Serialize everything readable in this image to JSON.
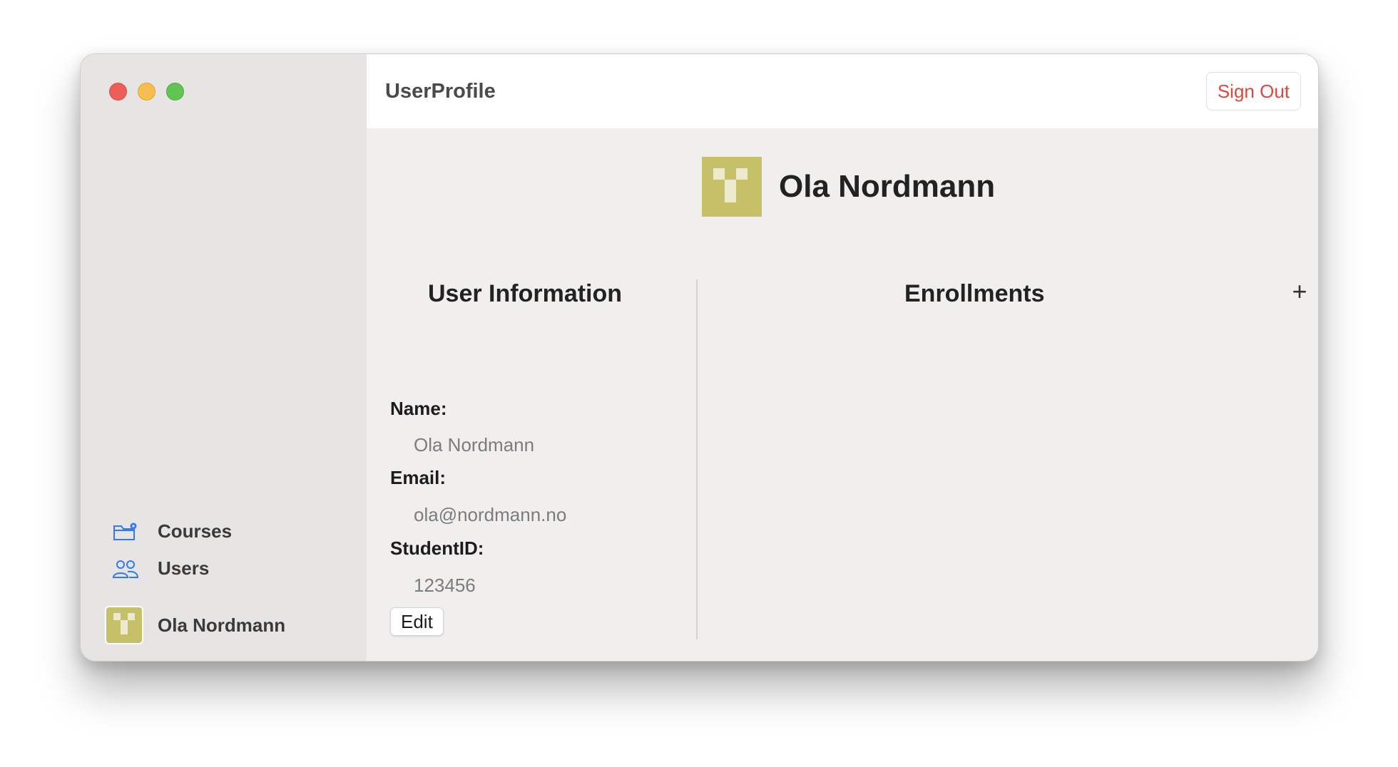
{
  "window": {
    "title": "UserProfile"
  },
  "toolbar": {
    "sign_out_label": "Sign Out"
  },
  "sidebar": {
    "items": [
      {
        "label": "Courses",
        "icon": "folder-gear-icon"
      },
      {
        "label": "Users",
        "icon": "users-icon"
      }
    ],
    "profile": {
      "name": "Ola Nordmann"
    }
  },
  "profile": {
    "display_name": "Ola Nordmann",
    "user_info": {
      "title": "User Information",
      "name_label": "Name:",
      "name_value": "Ola Nordmann",
      "email_label": "Email:",
      "email_value": "ola@nordmann.no",
      "student_id_label": "StudentID:",
      "student_id_value": "123456",
      "edit_label": "Edit"
    },
    "enrollments": {
      "title": "Enrollments",
      "add_label": "+"
    }
  },
  "colors": {
    "accent": "#3478f6",
    "destructive": "#e0463c",
    "avatar": "#c6c168"
  }
}
